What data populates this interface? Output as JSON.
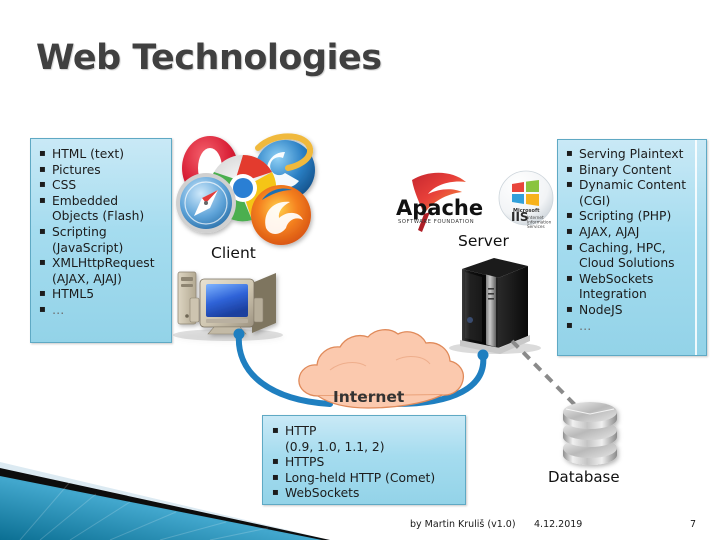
{
  "slide": {
    "title": "Web Technologies"
  },
  "client_panel": {
    "label": "Client",
    "logos": [
      "opera-logo",
      "chrome-logo",
      "internet-explorer-logo",
      "safari-logo",
      "firefox-logo"
    ],
    "device": "desktop-computer-icon",
    "bullets": [
      "HTML (text)",
      "Pictures",
      "CSS",
      "Embedded\nObjects (Flash)",
      "Scripting\n(JavaScript)",
      "XMLHttpRequest\n(AJAX, AJAJ)",
      "HTML5",
      "…"
    ]
  },
  "server_panel": {
    "label": "Server",
    "logos": [
      "apache-logo",
      "microsoft-iis-logo"
    ],
    "apache_logo_text": "Apache",
    "apache_logo_subtext": "SOFTWARE FOUNDATION",
    "iis_logo_text": "IIS",
    "device": "server-tower-icon",
    "bullets": [
      "Serving Plaintext",
      "Binary Content",
      "Dynamic Content\n(CGI)",
      "Scripting (PHP)",
      "AJAX, AJAJ",
      "Caching, HPC,\nCloud Solutions",
      "WebSockets\nIntegration",
      "NodeJS",
      "…"
    ]
  },
  "internet_panel": {
    "label": "Internet",
    "shape": "cloud-shape",
    "bullets": [
      "HTTP\n(0.9, 1.0, 1.1, 2)",
      "HTTPS",
      "Long-held HTTP (Comet)",
      "WebSockets"
    ]
  },
  "database_panel": {
    "label": "Database",
    "icon": "database-cylinder-icon"
  },
  "footer": {
    "author": "by Martin Kruliš (v1.0)",
    "date": "4.12.2019",
    "page": "7"
  },
  "colors": {
    "title": "#404040",
    "box_fill": "#a5dcef",
    "box_border": "#5fa9c4",
    "connector": "#1f7fc0",
    "cloud_fill": "#fbc9ae",
    "cloud_border": "#e08a5a",
    "dashed_link": "#8a8a8a",
    "corner_accent": "#1f8fb5"
  }
}
